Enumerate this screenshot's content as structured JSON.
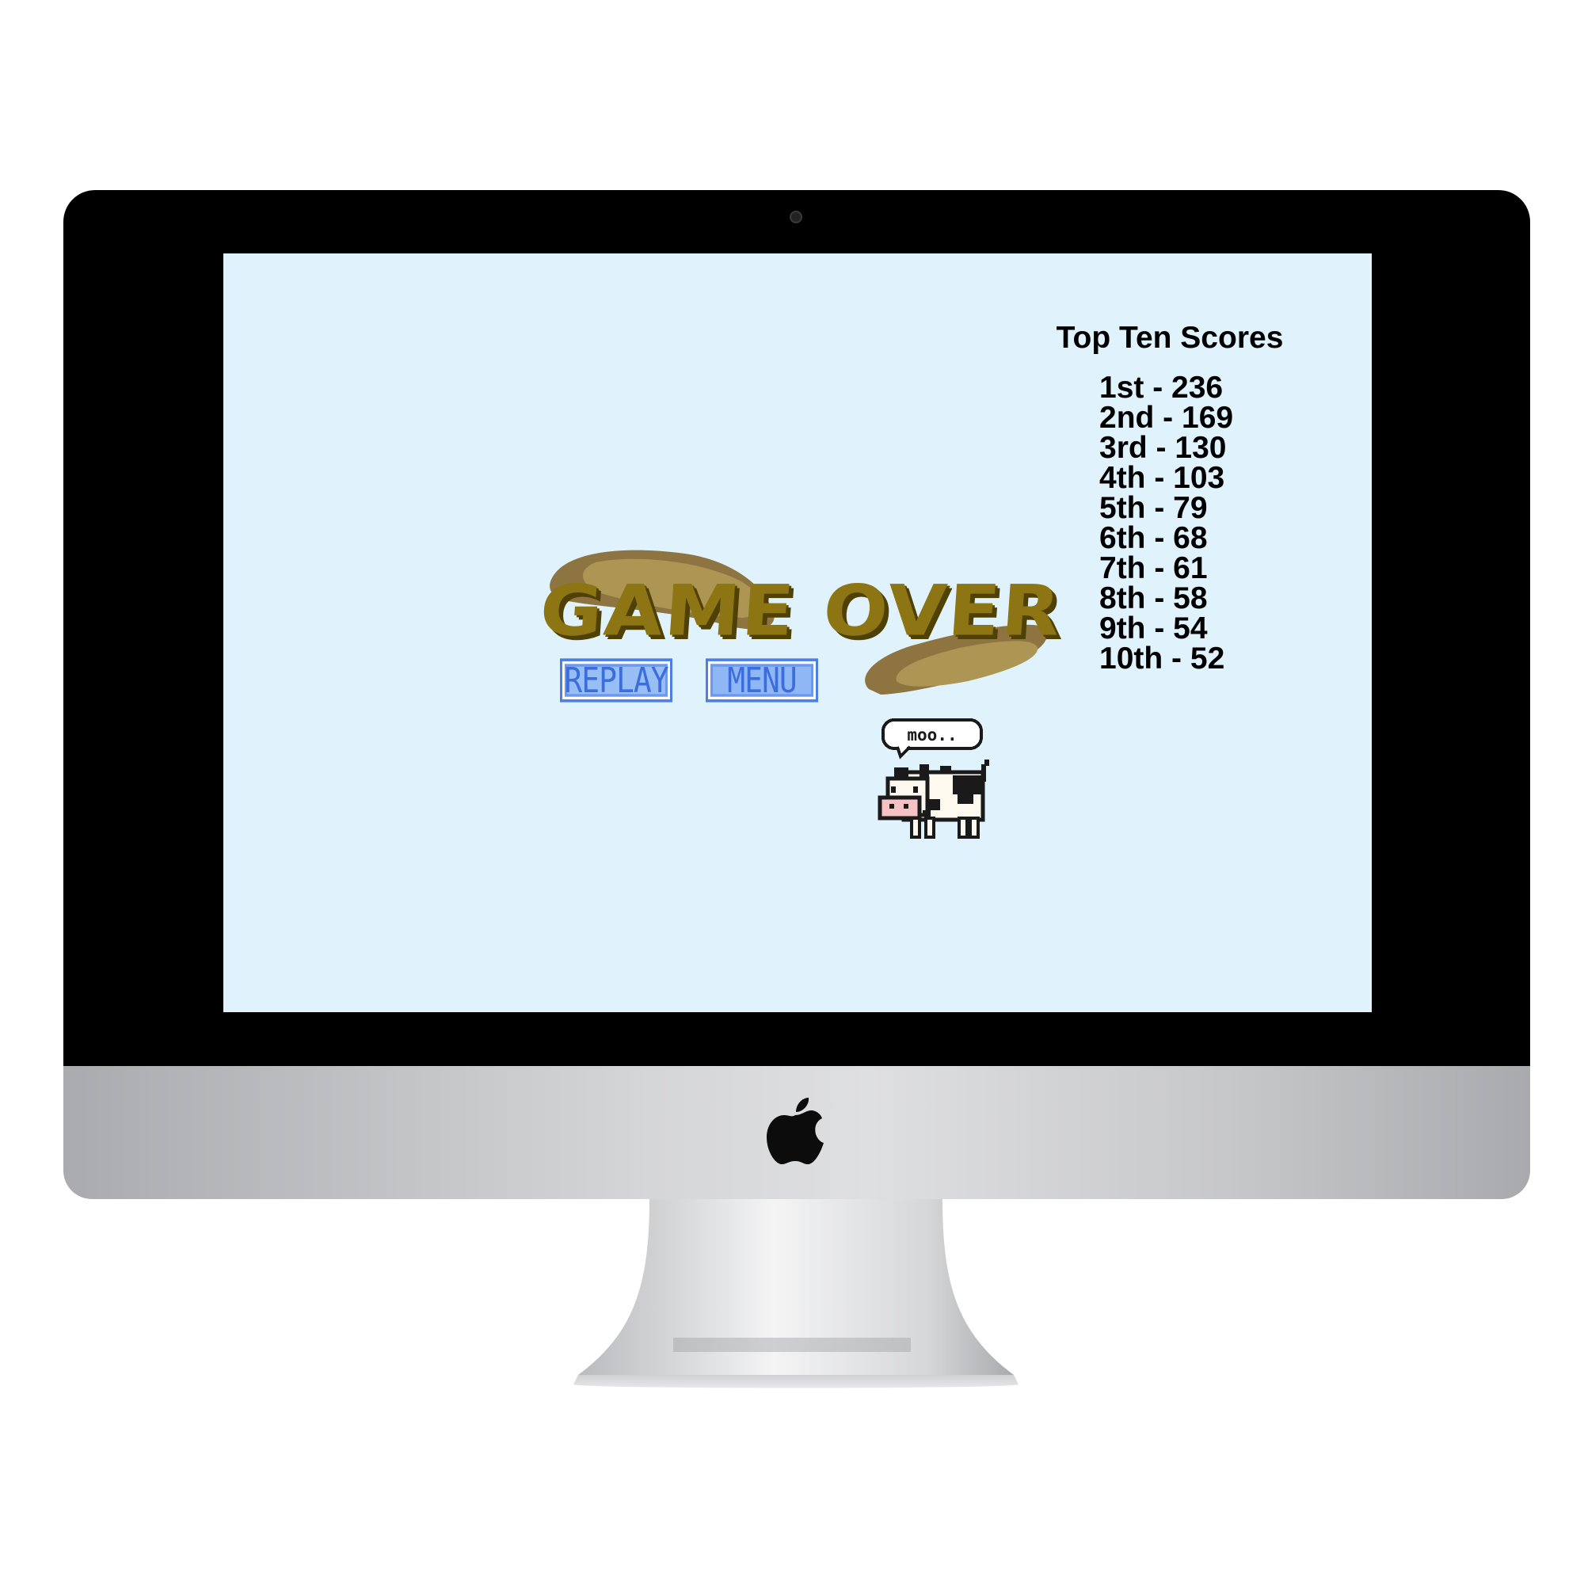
{
  "game": {
    "title": "GAME OVER",
    "buttons": {
      "replay_label": "REPLAY",
      "menu_label": "MENU"
    },
    "speech_bubble": "moo..",
    "scoreboard": {
      "title": "Top Ten Scores",
      "entries": [
        {
          "rank": "1st",
          "score": 236
        },
        {
          "rank": "2nd",
          "score": 169
        },
        {
          "rank": "3rd",
          "score": 130
        },
        {
          "rank": "4th",
          "score": 103
        },
        {
          "rank": "5th",
          "score": 79
        },
        {
          "rank": "6th",
          "score": 68
        },
        {
          "rank": "7th",
          "score": 61
        },
        {
          "rank": "8th",
          "score": 58
        },
        {
          "rank": "9th",
          "score": 54
        },
        {
          "rank": "10th",
          "score": 52
        }
      ]
    }
  },
  "colors": {
    "screen_background": "#e0f3fd",
    "title_gold": "#8c7512",
    "button_blue": "#98bff5",
    "button_border": "#4d7ee4"
  },
  "icons": {
    "device_logo": "apple-icon",
    "character": "cow-sprite"
  }
}
